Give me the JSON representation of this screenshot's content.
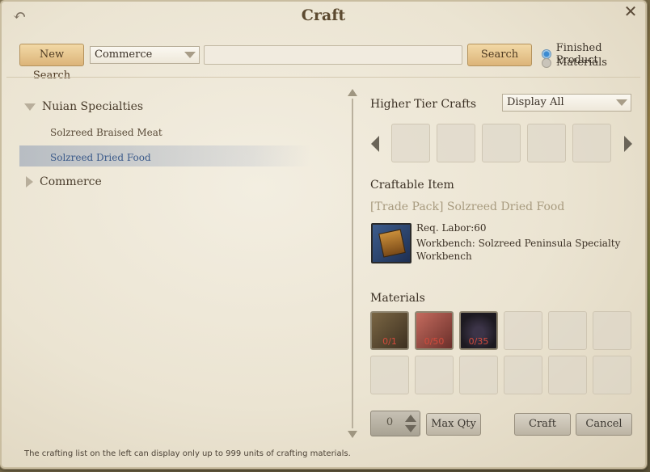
{
  "window": {
    "title": "Craft"
  },
  "search": {
    "new_search_label": "New Search",
    "category_value": "Commerce",
    "search_value": "",
    "search_label": "Search"
  },
  "filters": {
    "finished_product_label": "Finished Product",
    "materials_label": "Materials",
    "selected": "Finished Product"
  },
  "tree": {
    "groups": [
      {
        "label": "Nuian Specialties",
        "expanded": true,
        "items": [
          {
            "label": "Solzreed Braised Meat"
          },
          {
            "label": "Solzreed Dried Food",
            "selected": true
          }
        ]
      },
      {
        "label": "Commerce",
        "expanded": false,
        "items": []
      }
    ]
  },
  "higher_tier": {
    "title": "Higher Tier Crafts",
    "filter_value": "Display All"
  },
  "craftable": {
    "title": "Craftable Item",
    "item_name": "[Trade Pack] Solzreed Dried Food",
    "labor": "Req. Labor:60",
    "workbench": "Workbench: Solzreed Peninsula Specialty",
    "workbench_cont": "Workbench"
  },
  "materials": {
    "title": "Materials",
    "slots": [
      {
        "icon": "flour-sack-icon",
        "count": "0/1"
      },
      {
        "icon": "meat-icon",
        "count": "0/50"
      },
      {
        "icon": "grapes-icon",
        "count": "0/35"
      }
    ]
  },
  "controls": {
    "qty_value": "0",
    "max_qty_label": "Max Qty",
    "craft_label": "Craft",
    "cancel_label": "Cancel"
  },
  "footer_note": "The crafting list on the left can display only up to 999 units of crafting materials.",
  "colors": {
    "selected_row": "#8c9bb4",
    "count_text": "#d34b3c",
    "item_name": "#a89b7f"
  }
}
